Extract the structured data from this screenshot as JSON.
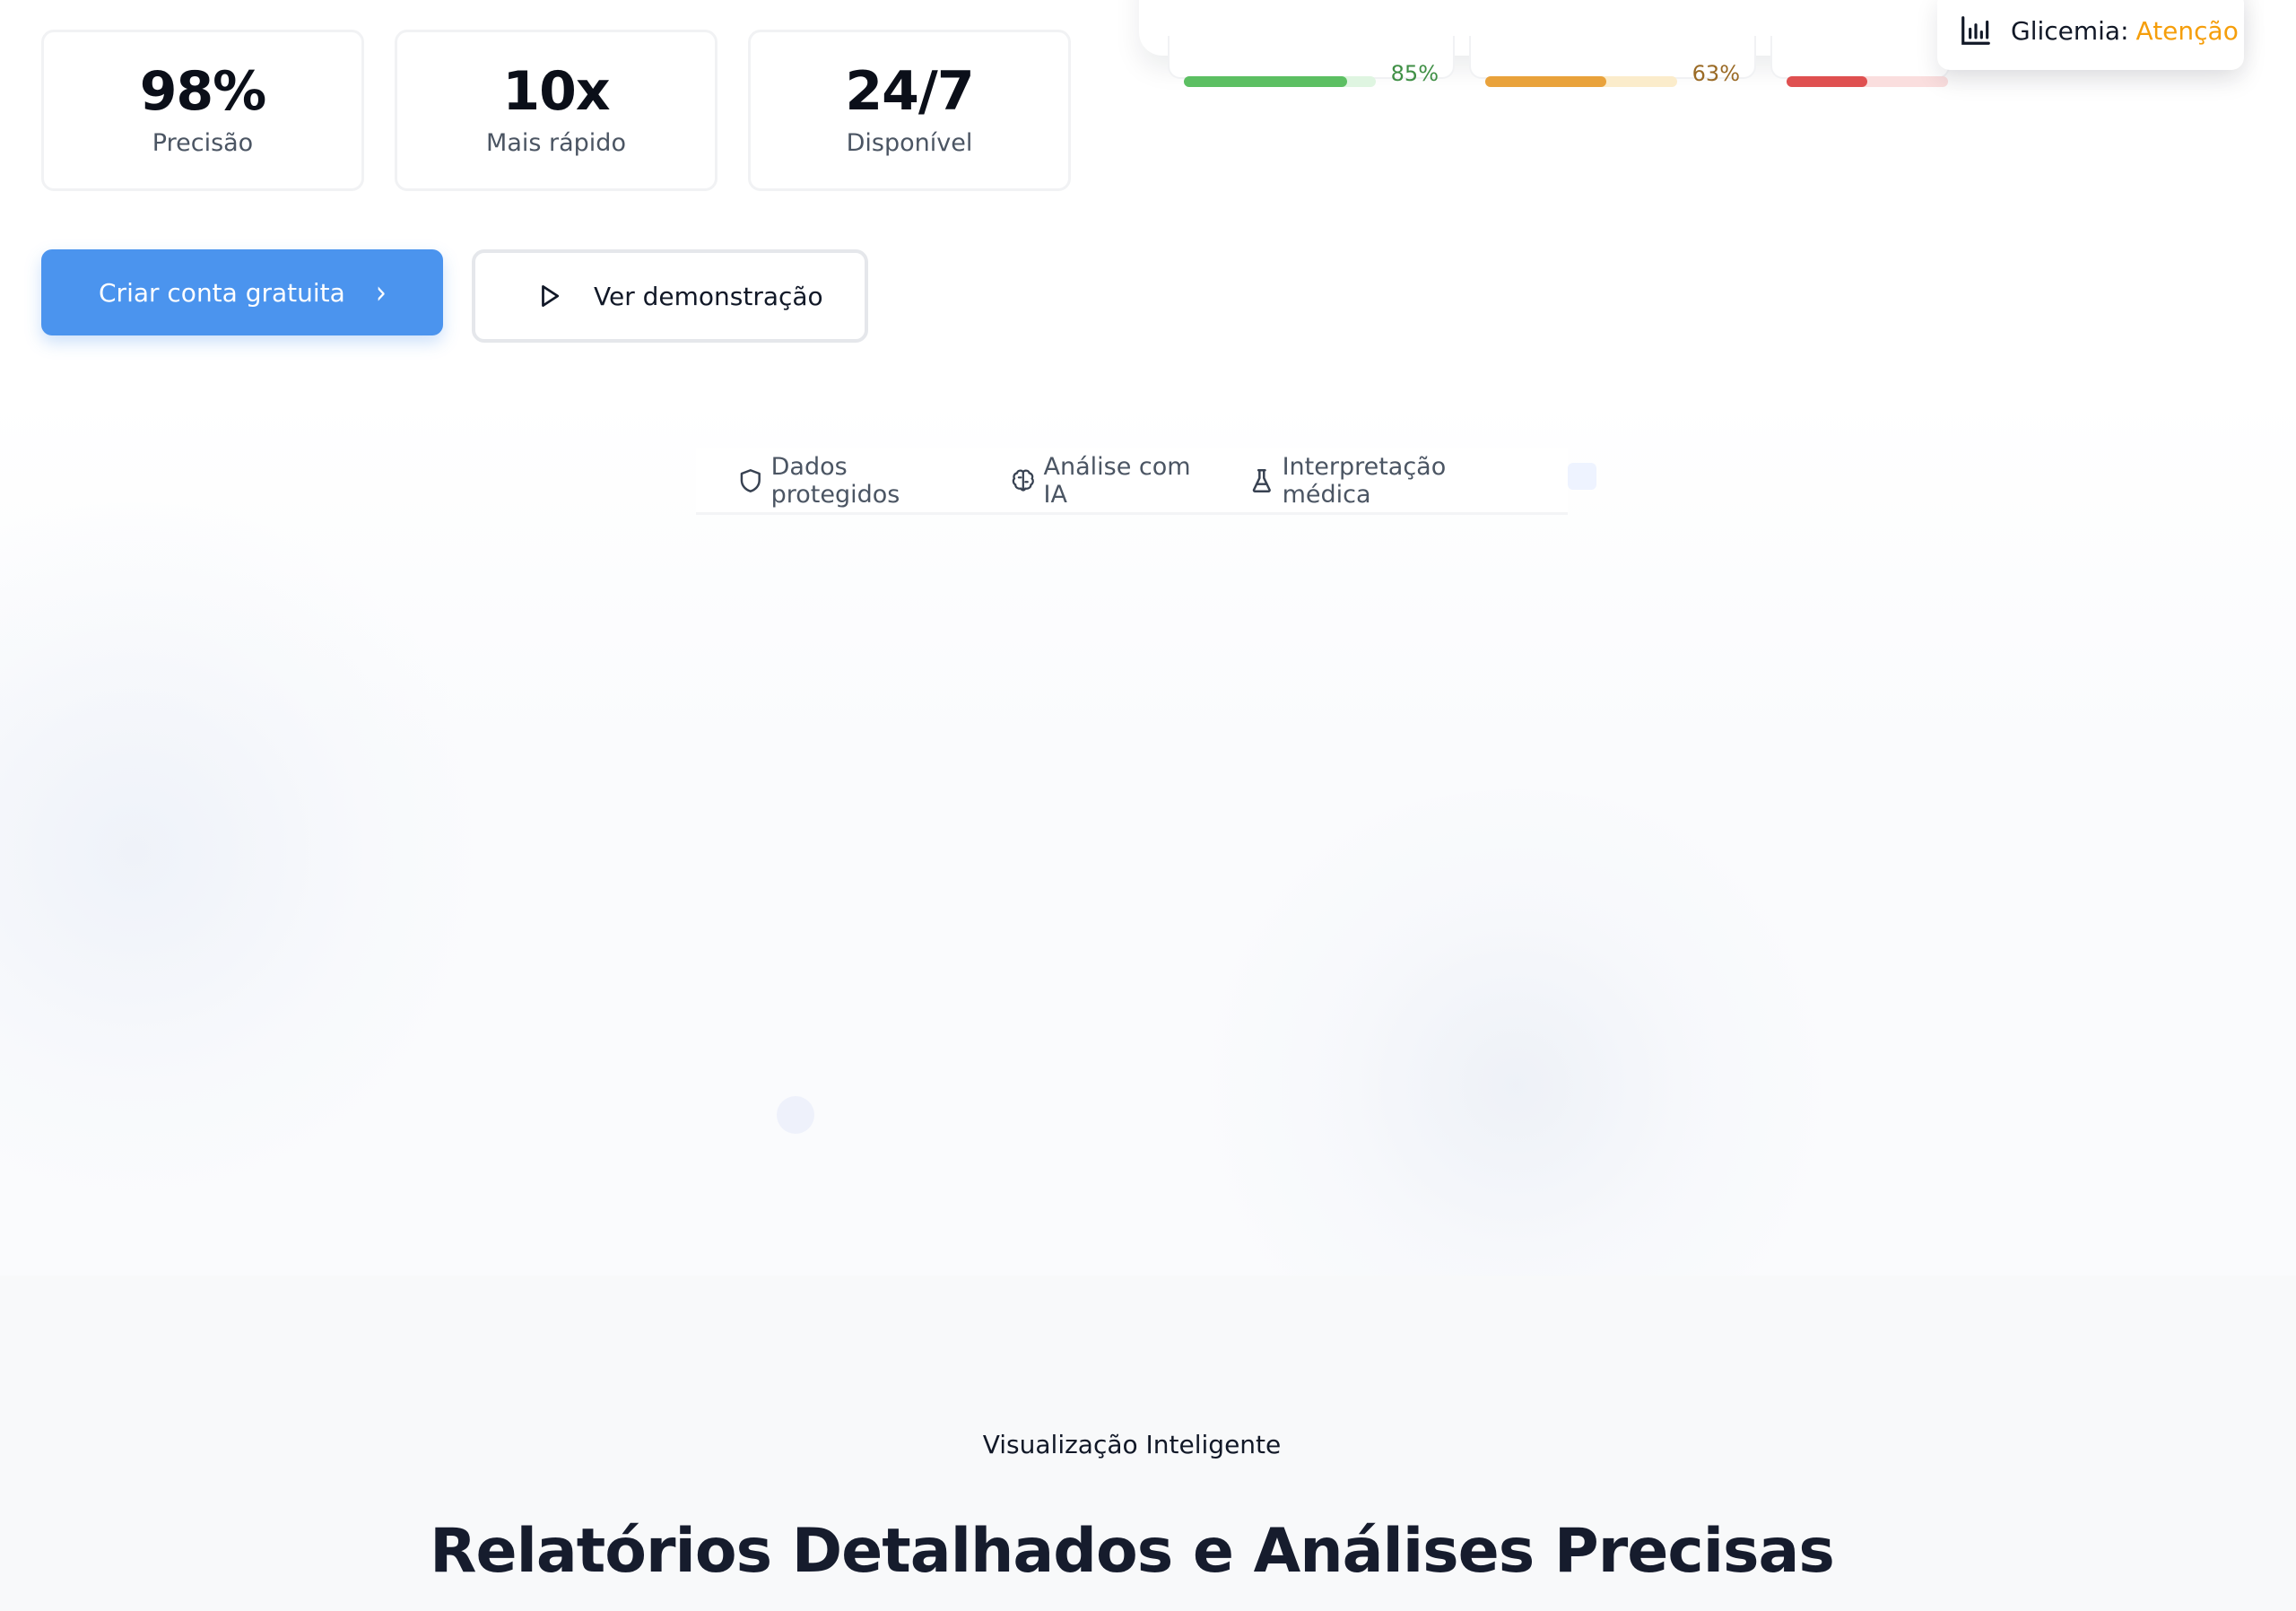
{
  "stats": [
    {
      "value": "98%",
      "label": "Precisão"
    },
    {
      "value": "10x",
      "label": "Mais rápido"
    },
    {
      "value": "24/7",
      "label": "Disponível"
    }
  ],
  "actions": {
    "primary_label": "Criar conta gratuita",
    "secondary_label": "Ver demonstração"
  },
  "trust_bar": {
    "items": [
      {
        "label": "Dados protegidos",
        "icon": "shield-icon"
      },
      {
        "label": "Análise com IA",
        "icon": "brain-icon"
      },
      {
        "label": "Interpretação médica",
        "icon": "flask-icon"
      }
    ]
  },
  "dashboard": {
    "meters": [
      {
        "percent_label": "85%",
        "fraction": 0.85,
        "color": "#5cbf62",
        "track": "#dff5e1",
        "text_color": "#3f8f45"
      },
      {
        "percent_label": "63%",
        "fraction": 0.63,
        "color": "#e9a23b",
        "track": "#fbeccb",
        "text_color": "#9a6a25"
      },
      {
        "percent_label": "",
        "fraction": 0.5,
        "color": "#df5050",
        "track": "#fadede",
        "text_color": "#b23b3b"
      }
    ],
    "badge": {
      "label": "Glicemia:",
      "status": "Atenção",
      "status_color": "#f59e0b",
      "icon": "bar-chart-icon"
    }
  },
  "section": {
    "eyebrow": "Visualização Inteligente",
    "heading": "Relatórios Detalhados e Análises Precisas"
  },
  "colors": {
    "primary": "#4b94ee",
    "heading": "#161c2d"
  }
}
